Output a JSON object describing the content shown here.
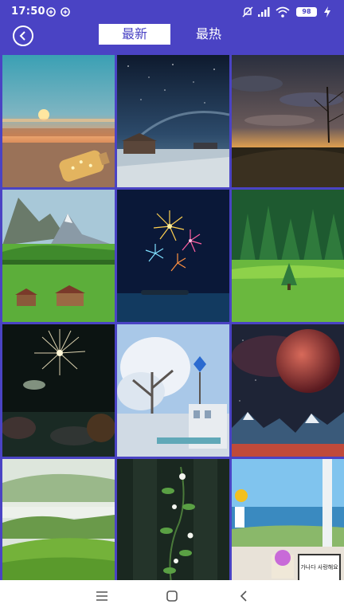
{
  "status_bar": {
    "time": "17:50",
    "battery": "98",
    "icons": [
      "notification-badge-icon",
      "notification-badge-icon",
      "mute-icon",
      "signal-icon",
      "wifi-icon",
      "battery-icon",
      "charging-icon"
    ]
  },
  "header": {
    "tabs": [
      {
        "label": "最新",
        "active": true
      },
      {
        "label": "最热",
        "active": false
      }
    ]
  },
  "gallery": {
    "tiles": [
      {
        "name": "wallpaper-sunset-bottle"
      },
      {
        "name": "wallpaper-starry-cabin"
      },
      {
        "name": "wallpaper-anime-sky-field"
      },
      {
        "name": "wallpaper-alpine-meadow"
      },
      {
        "name": "wallpaper-fireworks-lake"
      },
      {
        "name": "wallpaper-forest-meadow"
      },
      {
        "name": "wallpaper-night-fireworks"
      },
      {
        "name": "wallpaper-snow-tree-street"
      },
      {
        "name": "wallpaper-red-planet-mountains"
      },
      {
        "name": "wallpaper-misty-green-hills"
      },
      {
        "name": "wallpaper-flower-vine"
      },
      {
        "name": "wallpaper-window-seaside"
      }
    ],
    "handwritten_sign": "가나다 사랑해요"
  },
  "colors": {
    "accent": "#4a43c4",
    "background": "#ffffff"
  }
}
